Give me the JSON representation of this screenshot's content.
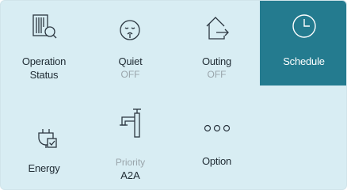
{
  "colors": {
    "panel_bg": "#d8edf3",
    "selected_bg": "#247b8f",
    "text": "#1f2b33",
    "muted_text": "#9aa5ab",
    "selected_text": "#ffffff"
  },
  "tiles": [
    {
      "id": "operation-status",
      "icon": "document-search-icon",
      "label_line1": "Operation",
      "label_line2": "Status",
      "selected": false
    },
    {
      "id": "quiet",
      "icon": "sleeping-face-icon",
      "label": "Quiet",
      "sub": "OFF",
      "selected": false
    },
    {
      "id": "outing",
      "icon": "house-exit-icon",
      "label": "Outing",
      "sub": "OFF",
      "selected": false
    },
    {
      "id": "schedule",
      "icon": "clock-icon",
      "label": "Schedule",
      "selected": true
    },
    {
      "id": "energy",
      "icon": "plug-check-icon",
      "label": "Energy",
      "selected": false
    },
    {
      "id": "priority",
      "icon": "faucet-icon",
      "label": "Priority",
      "sub": "A2A",
      "selected": false
    },
    {
      "id": "option",
      "icon": "more-dots-icon",
      "label": "Option",
      "selected": false
    }
  ]
}
